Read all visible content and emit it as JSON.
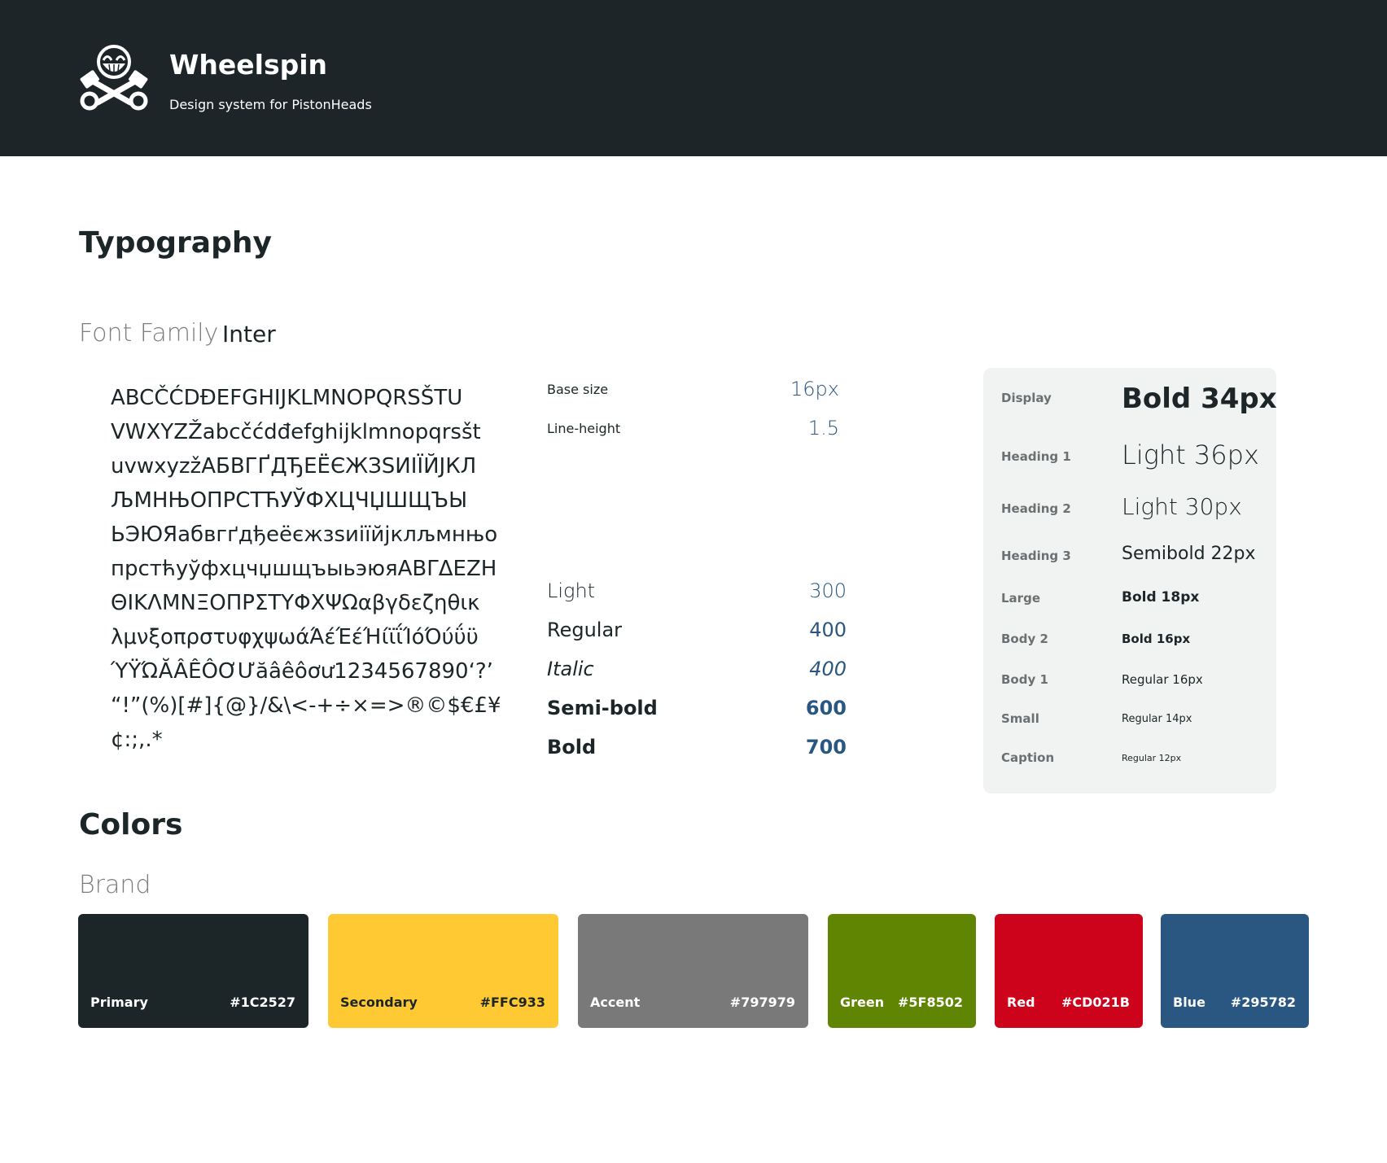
{
  "header": {
    "title": "Wheelspin",
    "subtitle": "Design system for PistonHeads"
  },
  "typography": {
    "heading": "Typography",
    "font_family_label": "Font Family",
    "font_family_value": "Inter",
    "charset_lines": [
      "ABCČĆDĐEFGHIJKLMNOPQRSŠTU",
      "VWXYZŽabcčćdđefghijklmnopqrsšt",
      "uvwxyzžАБВГҐДЂЕЁЄЖЗЅИІЇЙЈКЛ",
      "ЉМНЊОПРСТЋУЎФХЦЧЏШЩЪЫ",
      "ЬЭЮЯабвгґдђеёєжзѕиіїйјклљмнњо",
      "прстћуўфхцчџшщъыьэюяΑΒΓΔΕΖΗ",
      "ΘΙΚΛΜΝΞΟΠΡΣΤΥΦΧΨΩαβγδεζηθικ",
      "λμνξοπρστυφχψωάΆέΈέΉίϊΐΊόΌύΰϋ",
      "ΎΫΏĂÂÊÔƠƯăâêôơư1234567890‘?’",
      "“!”(%)[#]{@}/&\\<-+÷×=>®©$€£¥",
      "¢:;,.*"
    ],
    "metrics": [
      {
        "label": "Base size",
        "value": "16px"
      },
      {
        "label": "Line-height",
        "value": "1.5"
      }
    ],
    "weights": [
      {
        "label": "Light",
        "value": "300"
      },
      {
        "label": "Regular",
        "value": "400"
      },
      {
        "label": "Italic",
        "value": "400"
      },
      {
        "label": "Semi-bold",
        "value": "600"
      },
      {
        "label": "Bold",
        "value": "700"
      }
    ],
    "scale": [
      {
        "label": "Display",
        "sample": "Bold 34px"
      },
      {
        "label": "Heading 1",
        "sample": "Light 36px"
      },
      {
        "label": "Heading 2",
        "sample": "Light 30px"
      },
      {
        "label": "Heading 3",
        "sample": "Semibold 22px"
      },
      {
        "label": "Large",
        "sample": "Bold 18px"
      },
      {
        "label": "Body 2",
        "sample": "Bold 16px"
      },
      {
        "label": "Body 1",
        "sample": "Regular 16px"
      },
      {
        "label": "Small",
        "sample": "Regular 14px"
      },
      {
        "label": "Caption",
        "sample": "Regular 12px"
      }
    ]
  },
  "colors": {
    "heading": "Colors",
    "brand_label": "Brand",
    "swatches": [
      {
        "name": "Primary",
        "hex": "#1C2527",
        "color": "#1C2527",
        "text_color": "#ffffff"
      },
      {
        "name": "Secondary",
        "hex": "#FFC933",
        "color": "#FFC933",
        "text_color": "#1C2527"
      },
      {
        "name": "Accent",
        "hex": "#797979",
        "color": "#797979",
        "text_color": "#ffffff"
      },
      {
        "name": "Green",
        "hex": "#5F8502",
        "color": "#5F8502",
        "text_color": "#ffffff"
      },
      {
        "name": "Red",
        "hex": "#CD021B",
        "color": "#CD021B",
        "text_color": "#ffffff"
      },
      {
        "name": "Blue",
        "hex": "#295782",
        "color": "#295782",
        "text_color": "#ffffff"
      }
    ]
  }
}
